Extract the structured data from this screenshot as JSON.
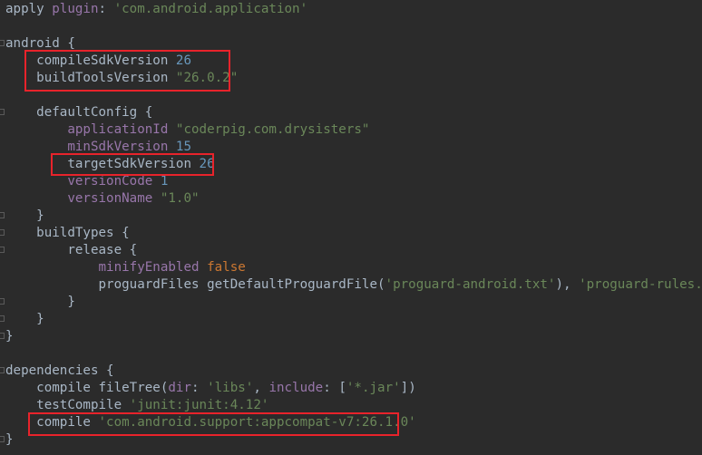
{
  "lines": [
    {
      "segments": [
        {
          "t": "apply ",
          "c": "plain"
        },
        {
          "t": "plugin",
          "c": "named"
        },
        {
          "t": ": ",
          "c": "plain"
        },
        {
          "t": "'com.android.application'",
          "c": "str"
        }
      ]
    },
    {
      "segments": []
    },
    {
      "segments": [
        {
          "t": "android {",
          "c": "plain"
        }
      ]
    },
    {
      "segments": [
        {
          "t": "    compileSdkVersion ",
          "c": "plain"
        },
        {
          "t": "26",
          "c": "num"
        }
      ]
    },
    {
      "segments": [
        {
          "t": "    buildToolsVersion ",
          "c": "plain"
        },
        {
          "t": "\"26.0.2\"",
          "c": "str"
        }
      ]
    },
    {
      "segments": []
    },
    {
      "segments": [
        {
          "t": "    defaultConfig {",
          "c": "plain"
        }
      ]
    },
    {
      "segments": [
        {
          "t": "        applicationId ",
          "c": "prop"
        },
        {
          "t": "\"coderpig.com.drysisters\"",
          "c": "str"
        }
      ]
    },
    {
      "segments": [
        {
          "t": "        minSdkVersion ",
          "c": "prop"
        },
        {
          "t": "15",
          "c": "num"
        }
      ]
    },
    {
      "segments": [
        {
          "t": "        targetSdkVersion ",
          "c": "plain"
        },
        {
          "t": "26",
          "c": "num"
        }
      ]
    },
    {
      "segments": [
        {
          "t": "        versionCode ",
          "c": "prop"
        },
        {
          "t": "1",
          "c": "num"
        }
      ]
    },
    {
      "segments": [
        {
          "t": "        versionName ",
          "c": "prop"
        },
        {
          "t": "\"1.0\"",
          "c": "str"
        }
      ]
    },
    {
      "segments": [
        {
          "t": "    }",
          "c": "plain"
        }
      ]
    },
    {
      "segments": [
        {
          "t": "    buildTypes {",
          "c": "plain"
        }
      ]
    },
    {
      "segments": [
        {
          "t": "        release {",
          "c": "plain"
        }
      ]
    },
    {
      "segments": [
        {
          "t": "            minifyEnabled ",
          "c": "prop"
        },
        {
          "t": "false",
          "c": "kw"
        }
      ]
    },
    {
      "segments": [
        {
          "t": "            proguardFiles getDefaultProguardFile(",
          "c": "plain"
        },
        {
          "t": "'proguard-android.txt'",
          "c": "str"
        },
        {
          "t": "), ",
          "c": "plain"
        },
        {
          "t": "'proguard-rules.pro'",
          "c": "str"
        }
      ]
    },
    {
      "segments": [
        {
          "t": "        }",
          "c": "plain"
        }
      ]
    },
    {
      "segments": [
        {
          "t": "    }",
          "c": "plain"
        }
      ]
    },
    {
      "segments": [
        {
          "t": "}",
          "c": "plain"
        }
      ]
    },
    {
      "segments": []
    },
    {
      "segments": [
        {
          "t": "dependencies {",
          "c": "plain"
        }
      ]
    },
    {
      "segments": [
        {
          "t": "    compile fileTree(",
          "c": "plain"
        },
        {
          "t": "dir",
          "c": "named"
        },
        {
          "t": ": ",
          "c": "plain"
        },
        {
          "t": "'libs'",
          "c": "str"
        },
        {
          "t": ", ",
          "c": "plain"
        },
        {
          "t": "include",
          "c": "named"
        },
        {
          "t": ": [",
          "c": "plain"
        },
        {
          "t": "'*.jar'",
          "c": "str"
        },
        {
          "t": "])",
          "c": "plain"
        }
      ]
    },
    {
      "segments": [
        {
          "t": "    testCompile ",
          "c": "plain"
        },
        {
          "t": "'junit:junit:4.12'",
          "c": "str"
        }
      ]
    },
    {
      "segments": [
        {
          "t": "    compile ",
          "c": "plain"
        },
        {
          "t": "'com.android.support:appcompat-v7:26.1.0'",
          "c": "str"
        }
      ]
    },
    {
      "segments": [
        {
          "t": "}",
          "c": "plain"
        }
      ]
    }
  ],
  "highlight_color": "#e8232b"
}
